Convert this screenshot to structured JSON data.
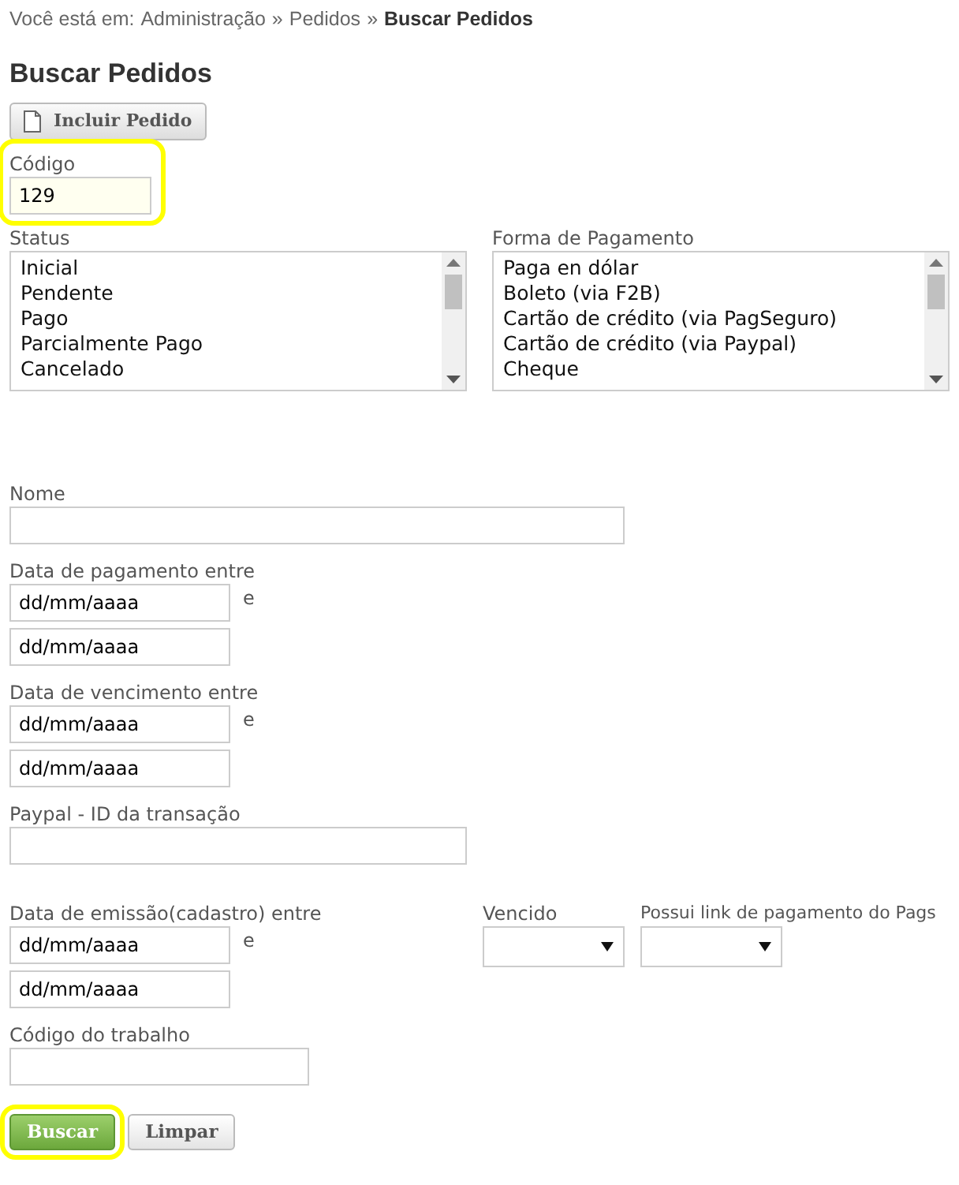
{
  "breadcrumb": {
    "prefix": "Você está em:",
    "items": [
      {
        "label": "Administração",
        "current": false
      },
      {
        "label": "Pedidos",
        "current": false
      },
      {
        "label": "Buscar Pedidos",
        "current": true
      }
    ],
    "separators": [
      "»",
      "»"
    ]
  },
  "title": "Buscar Pedidos",
  "toolbar_button": {
    "label": "Incluir Pedido"
  },
  "codigo": {
    "label": "Código",
    "value": "129",
    "highlighted": true
  },
  "lists": [
    {
      "label": "Status",
      "options": [
        "Inicial",
        "Pendente",
        "Pago",
        "Parcialmente Pago",
        "Cancelado"
      ]
    },
    {
      "label": "Forma de Pagamento",
      "options": [
        "Paga en dólar",
        "Boleto (via F2B)",
        "Cartão de crédito (via PagSeguro)",
        "Cartão de crédito (via Paypal)",
        "Cheque"
      ]
    }
  ],
  "nome": {
    "label": "Nome"
  },
  "date_ranges": [
    {
      "label": "Data de pagamento entre",
      "from": "dd/mm/aaaa",
      "joiner": "e",
      "to": "dd/mm/aaaa"
    },
    {
      "label": "Data de vencimento entre",
      "from": "dd/mm/aaaa",
      "joiner": "e",
      "to": "dd/mm/aaaa"
    }
  ],
  "paypal_id": {
    "label": "Paypal - ID da transação"
  },
  "emissao": {
    "label": "Data de emissão(cadastro) entre",
    "from": "dd/mm/aaaa",
    "joiner": "e",
    "to": "dd/mm/aaaa"
  },
  "selects": [
    {
      "label": "Vencido"
    },
    {
      "label": "Possui link de pagamento do Pags"
    }
  ],
  "codigo_trabalho": {
    "label": "Código do trabalho"
  },
  "buttons": [
    {
      "label": "Buscar",
      "kind": "primary",
      "highlighted": true
    },
    {
      "label": "Limpar",
      "kind": "secondary",
      "highlighted": false
    }
  ]
}
